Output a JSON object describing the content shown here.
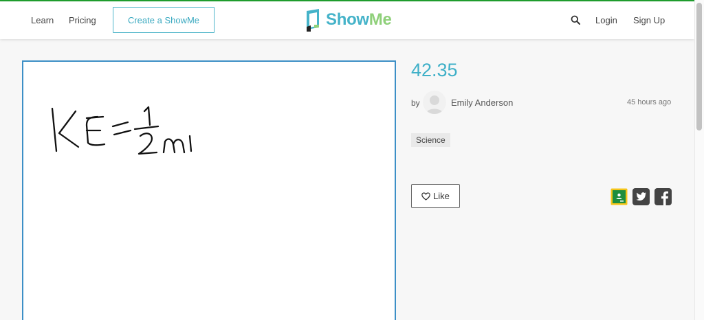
{
  "nav": {
    "learn": "Learn",
    "pricing": "Pricing",
    "create": "Create a ShowMe",
    "login": "Login",
    "signup": "Sign Up"
  },
  "logo": {
    "show": "Show",
    "me": "Me"
  },
  "icons": {
    "search": "search-icon",
    "classroom": "google-classroom-icon",
    "twitter": "twitter-icon",
    "facebook": "facebook-icon",
    "heart": "heart-icon",
    "avatar": "user-avatar-icon"
  },
  "showme": {
    "title": "42.35",
    "by_label": "by",
    "author": "Emily Anderson",
    "time": "45 hours ago",
    "tag": "Science",
    "like_label": "Like"
  },
  "colors": {
    "accent": "#45b3c9",
    "logo_green": "#8fd07a",
    "top_bar": "#1f9e2e",
    "player_border": "#3c8fc6",
    "classroom": "#1e8e3e",
    "classroom_border": "#f5c518"
  }
}
